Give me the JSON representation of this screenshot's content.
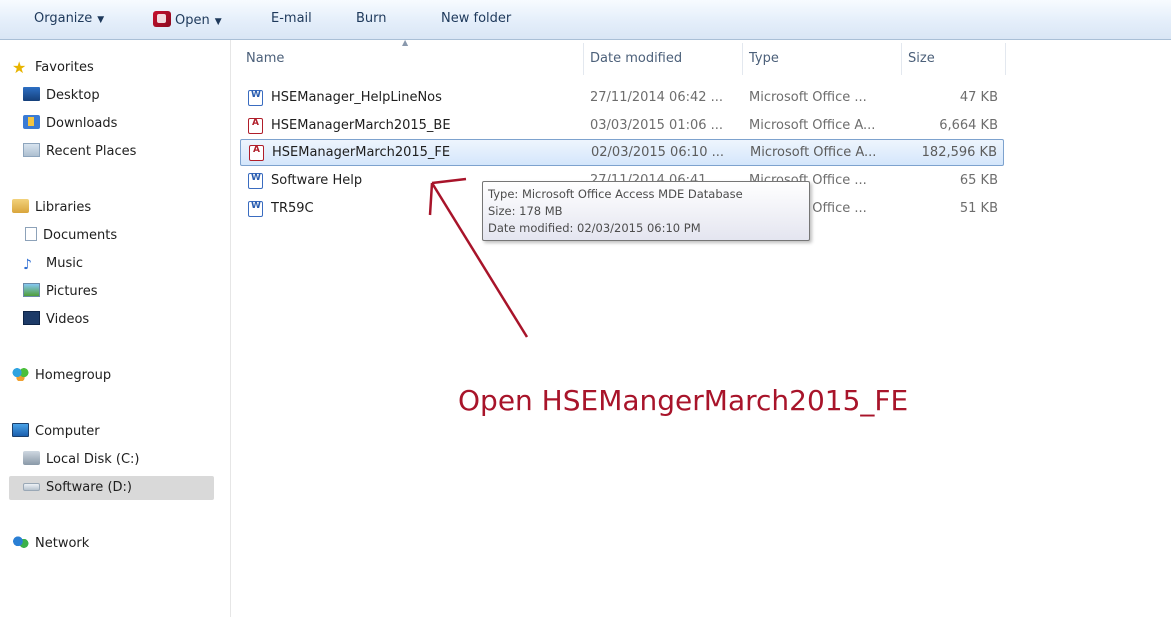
{
  "toolbar": {
    "organize": "Organize",
    "open": "Open",
    "email": "E-mail",
    "burn": "Burn",
    "new_folder": "New folder"
  },
  "nav": {
    "favorites": "Favorites",
    "desktop": "Desktop",
    "downloads": "Downloads",
    "recent_places": "Recent Places",
    "libraries": "Libraries",
    "documents": "Documents",
    "music": "Music",
    "pictures": "Pictures",
    "videos": "Videos",
    "homegroup": "Homegroup",
    "computer": "Computer",
    "local_disk": "Local Disk (C:)",
    "software_drive": "Software (D:)",
    "network": "Network"
  },
  "columns": {
    "name": "Name",
    "date_modified": "Date modified",
    "type": "Type",
    "size": "Size"
  },
  "files": [
    {
      "name": "HSEManager_HelpLineNos",
      "date": "27/11/2014 06:42 ...",
      "type": "Microsoft Office ...",
      "size": "47 KB",
      "icon": "word-doc-icon"
    },
    {
      "name": "HSEManagerMarch2015_BE",
      "date": "03/03/2015 01:06 ...",
      "type": "Microsoft Office A...",
      "size": "6,664 KB",
      "icon": "access-db-icon"
    },
    {
      "name": "HSEManagerMarch2015_FE",
      "date": "02/03/2015 06:10 ...",
      "type": "Microsoft Office A...",
      "size": "182,596 KB",
      "icon": "access-db-icon"
    },
    {
      "name": "Software Help",
      "date": "27/11/2014 06:41 ...",
      "type": "Microsoft Office ...",
      "size": "65 KB",
      "icon": "word-doc-icon"
    },
    {
      "name": "TR59C",
      "date": "",
      "type": "Microsoft Office ...",
      "size": "51 KB",
      "icon": "word-doc-icon"
    }
  ],
  "tooltip": {
    "type": "Type: Microsoft Office Access MDE Database",
    "size": "Size: 178 MB",
    "date_modified": "Date modified: 02/03/2015 06:10 PM"
  },
  "annotation": {
    "text": "Open HSEMangerMarch2015_FE",
    "color": "#a8142a"
  },
  "colors": {
    "selection_fill": "#d4e6fb",
    "selection_border": "#7da2ce"
  }
}
